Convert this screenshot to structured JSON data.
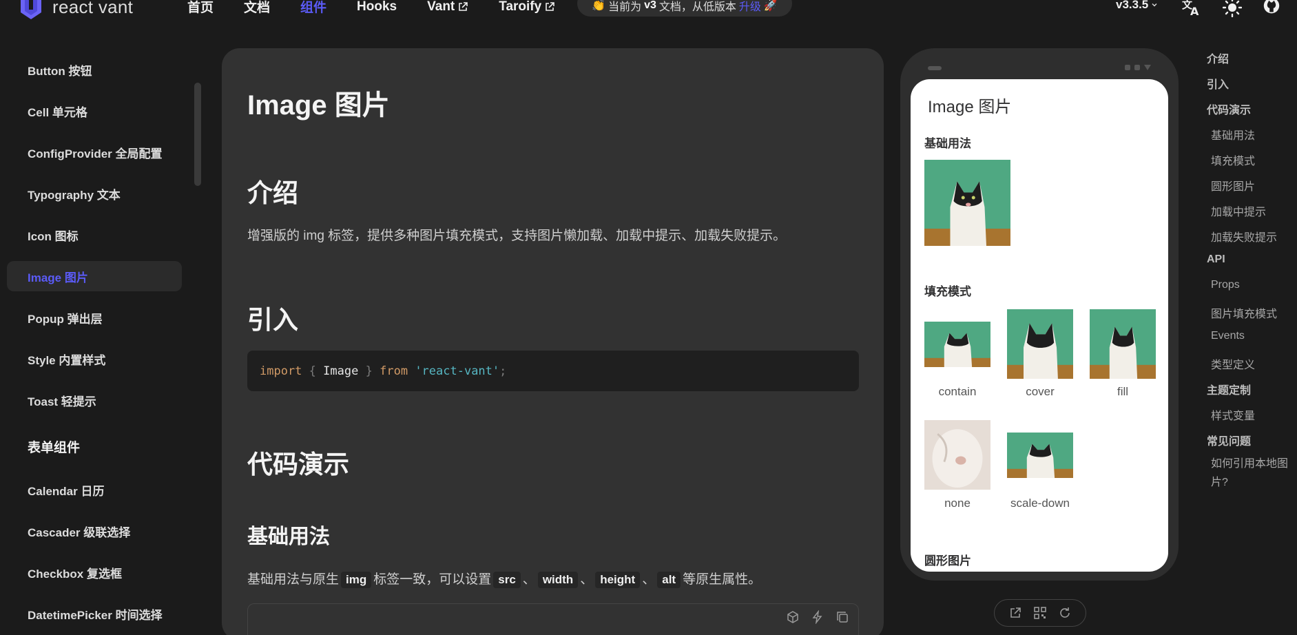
{
  "header": {
    "logo_text": "react vant",
    "nav": [
      {
        "label": "首页",
        "active": false,
        "external": false
      },
      {
        "label": "文档",
        "active": false,
        "external": false
      },
      {
        "label": "组件",
        "active": true,
        "external": false
      },
      {
        "label": "Hooks",
        "active": false,
        "external": false
      },
      {
        "label": "Vant",
        "active": false,
        "external": true
      },
      {
        "label": "Taroify",
        "active": false,
        "external": true
      }
    ],
    "notice": {
      "prefix": "当前为",
      "version": "v3",
      "middle": "文档，从低版本",
      "link": "升级",
      "emoji_left": "👏",
      "emoji_right": "🚀"
    },
    "version": "v3.3.5",
    "icons": [
      "translate-icon",
      "theme-sun-icon",
      "github-icon"
    ]
  },
  "sidebar": {
    "items": [
      {
        "label": "Button 按钮",
        "active": false
      },
      {
        "label": "Cell 单元格",
        "active": false
      },
      {
        "label": "ConfigProvider 全局配置",
        "active": false
      },
      {
        "label": "Typography 文本",
        "active": false
      },
      {
        "label": "Icon 图标",
        "active": false
      },
      {
        "label": "Image 图片",
        "active": true
      },
      {
        "label": "Popup 弹出层",
        "active": false
      },
      {
        "label": "Style 内置样式",
        "active": false
      },
      {
        "label": "Toast 轻提示",
        "active": false
      }
    ],
    "group": "表单组件",
    "group_items": [
      {
        "label": "Calendar 日历"
      },
      {
        "label": "Cascader 级联选择"
      },
      {
        "label": "Checkbox 复选框"
      },
      {
        "label": "DatetimePicker 时间选择"
      }
    ]
  },
  "doc": {
    "title": "Image 图片",
    "intro_heading": "介绍",
    "intro_text": "增强版的 img 标签，提供多种图片填充模式，支持图片懒加载、加载中提示、加载失败提示。",
    "import_heading": "引入",
    "code": {
      "kw_import": "import",
      "lbrace": "{",
      "ident": "Image",
      "rbrace": "}",
      "kw_from": "from",
      "string": "'react-vant'",
      "semi": ";"
    },
    "demo_heading": "代码演示",
    "basic_heading": "基础用法",
    "basic_text": {
      "before": "基础用法与原生",
      "code1": "img",
      "mid1": "标签一致，可以设置",
      "code2": "src",
      "sep1": "、",
      "code3": "width",
      "sep2": "、",
      "code4": "height",
      "sep3": "、",
      "code5": "alt",
      "after": "等原生属性。"
    }
  },
  "preview": {
    "title": "Image 图片",
    "sections": {
      "basic": "基础用法",
      "fit": "填充模式",
      "round": "圆形图片"
    },
    "fit_captions": [
      "contain",
      "cover",
      "fill",
      "none",
      "scale-down"
    ]
  },
  "toc": [
    {
      "label": "介绍",
      "level": 1
    },
    {
      "label": "引入",
      "level": 1
    },
    {
      "label": "代码演示",
      "level": 1
    },
    {
      "label": "基础用法",
      "level": 2
    },
    {
      "label": "填充模式",
      "level": 2
    },
    {
      "label": "圆形图片",
      "level": 2
    },
    {
      "label": "加载中提示",
      "level": 2
    },
    {
      "label": "加载失败提示",
      "level": 2
    },
    {
      "label": "API",
      "level": 1
    },
    {
      "label": "Props",
      "level": 2
    },
    {
      "label": "图片填充模式",
      "level": 2
    },
    {
      "label": "Events",
      "level": 2
    },
    {
      "label": "类型定义",
      "level": 2
    },
    {
      "label": "主题定制",
      "level": 1
    },
    {
      "label": "样式变量",
      "level": 2
    },
    {
      "label": "常见问题",
      "level": 1
    },
    {
      "label": "如何引用本地图片?",
      "level": 2
    }
  ],
  "colors": {
    "accent": "#5b5bf7",
    "page_bg": "#1b1b1b",
    "card_bg": "#323232"
  }
}
